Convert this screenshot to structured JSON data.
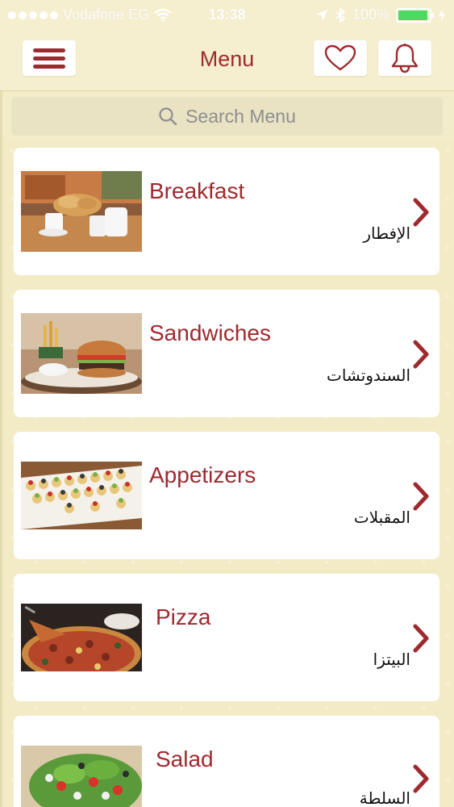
{
  "status_bar": {
    "carrier": "Vodafone EG",
    "time": "13:38",
    "battery": "100%"
  },
  "nav": {
    "title": "Menu"
  },
  "search": {
    "placeholder": "Search Menu"
  },
  "categories": [
    {
      "title": "Breakfast",
      "arabic": "الإفطار",
      "image": "breakfast-photo"
    },
    {
      "title": "Sandwiches",
      "arabic": "السندوتشات",
      "image": "sandwich-photo"
    },
    {
      "title": "Appetizers",
      "arabic": "المقبلات",
      "image": "appetizers-photo"
    },
    {
      "title": "Pizza",
      "arabic": "البيتزا",
      "image": "pizza-photo"
    },
    {
      "title": "Salad",
      "arabic": "السلطة",
      "image": "salad-photo"
    }
  ],
  "colors": {
    "accent": "#9e2a2f",
    "background": "#f3ebc6",
    "battery": "#4cd964"
  }
}
